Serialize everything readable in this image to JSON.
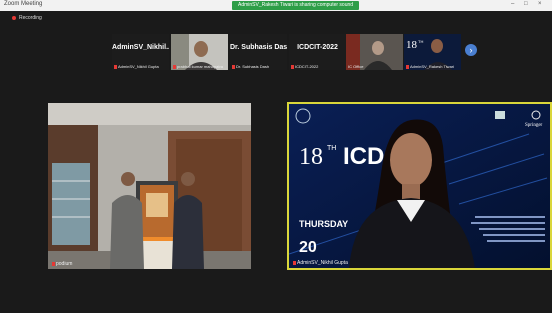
{
  "window": {
    "title": "Zoom Meeting",
    "controls": [
      "–",
      "□",
      "×"
    ]
  },
  "share_banner": {
    "text": "AdminSV_Rakesh Tiwari is sharing computer sound"
  },
  "recording": {
    "label": "Recording"
  },
  "colors": {
    "mic_muted": "#e53935",
    "speaker_highlight": "#d9d63a",
    "banner_green": "#2e9e48",
    "nav_button": "#4a7fd0"
  },
  "gallery_strip": [
    {
      "display": "AdminSV_Nikhil...",
      "label": "AdminSV_Nikhil Gupta",
      "muted": true
    },
    {
      "display": "",
      "label": "prabhat kumar mahapatra",
      "muted": true,
      "video": true
    },
    {
      "display": "Dr. Subhasis Dash",
      "label": "Dr. Subhasis Dash",
      "muted": true
    },
    {
      "display": "ICDCIT-2022",
      "label": "ICDCIT-2022",
      "muted": true
    },
    {
      "display": "",
      "label": "IC Office",
      "muted": false,
      "video": true
    },
    {
      "display": "",
      "label": "AdminSV_Rakesh Tiwari",
      "muted": true,
      "video": true
    }
  ],
  "strip_next_icon": "chevron-right-icon",
  "main_tiles": [
    {
      "label": "podium",
      "muted": true
    },
    {
      "label": "AdminSV_Nikhil Gupta",
      "muted": true,
      "active_speaker": true
    }
  ],
  "backdrop": {
    "edition": "18",
    "edition_sup": "TH",
    "conf": "ICD",
    "day": "THURSDAY",
    "date": "20",
    "publisher": "Springer"
  }
}
